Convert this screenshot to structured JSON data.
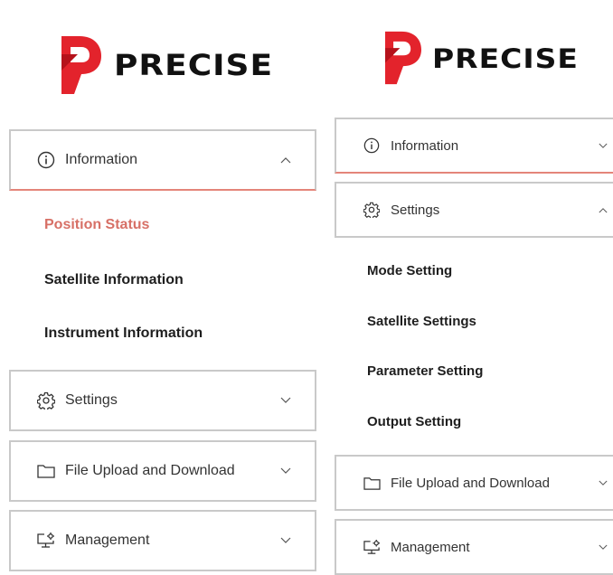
{
  "brand": {
    "name": "PRECISE",
    "logo_color": "#e3232c"
  },
  "left": {
    "menu": {
      "information": {
        "label": "Information",
        "state": "expanded"
      },
      "information_items": [
        {
          "label": "Position Status",
          "active": true
        },
        {
          "label": "Satellite Information",
          "active": false
        },
        {
          "label": "Instrument Information",
          "active": false
        }
      ],
      "settings": {
        "label": "Settings",
        "state": "collapsed"
      },
      "file": {
        "label": "File Upload and Download",
        "state": "collapsed"
      },
      "management": {
        "label": "Management",
        "state": "collapsed"
      }
    }
  },
  "right": {
    "menu": {
      "information": {
        "label": "Information",
        "state": "collapsed"
      },
      "settings": {
        "label": "Settings",
        "state": "expanded"
      },
      "settings_items": [
        {
          "label": "Mode Setting"
        },
        {
          "label": "Satellite Settings"
        },
        {
          "label": "Parameter Setting"
        },
        {
          "label": "Output Setting"
        }
      ],
      "file": {
        "label": "File Upload and Download",
        "state": "collapsed"
      },
      "management": {
        "label": "Management",
        "state": "collapsed"
      }
    }
  },
  "colors": {
    "active_text": "#d77066",
    "active_border": "#e4857a",
    "item_border": "#c9c9c9"
  },
  "icons": [
    "info-icon",
    "gear-icon",
    "folder-icon",
    "monitor-gear-icon",
    "chevron-up-icon",
    "chevron-down-icon"
  ]
}
